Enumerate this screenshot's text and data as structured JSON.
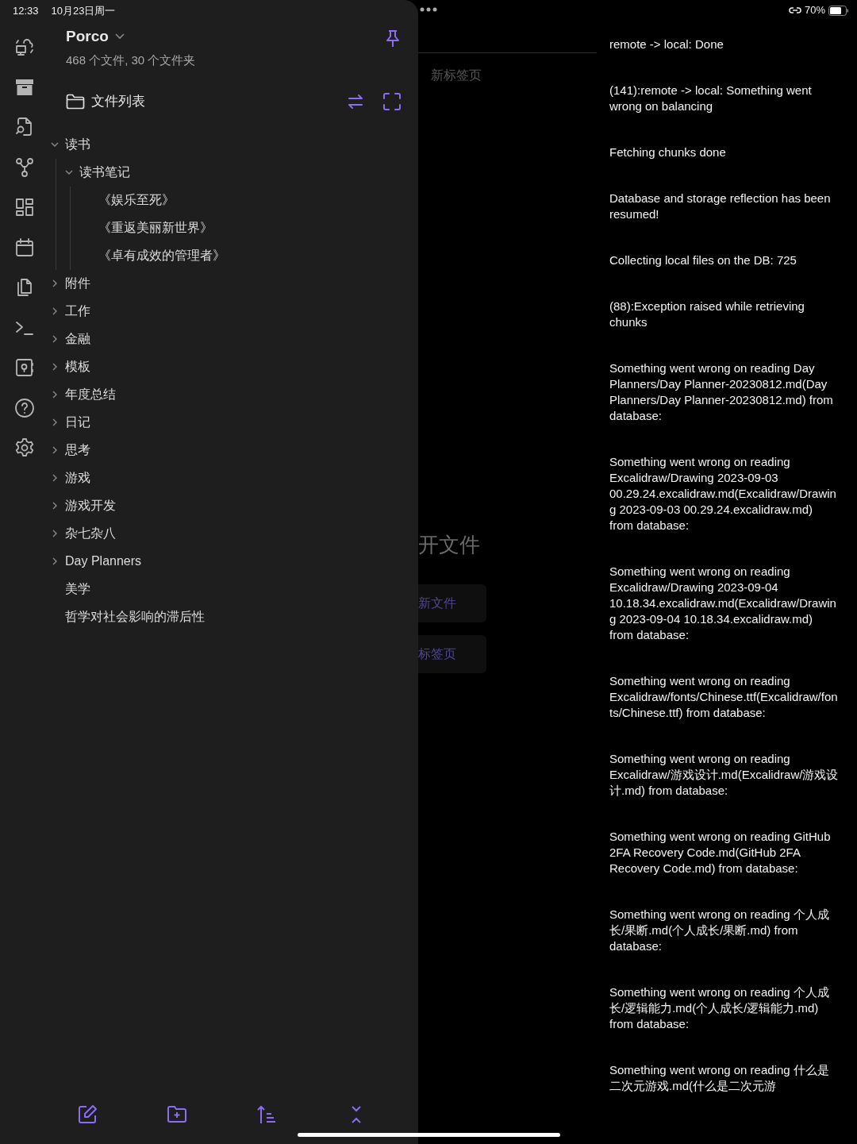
{
  "status_bar": {
    "time": "12:33",
    "date": "10月23日周一",
    "battery": "70%"
  },
  "vault": {
    "name": "Porco",
    "summary": "468 个文件, 30 个文件夹"
  },
  "file_pane": {
    "title": "文件列表"
  },
  "tree": [
    {
      "label": "读书",
      "kind": "folder",
      "expanded": true,
      "children": [
        {
          "label": "读书笔记",
          "kind": "folder",
          "expanded": true,
          "children": [
            {
              "label": "《娱乐至死》",
              "kind": "file"
            },
            {
              "label": "《重返美丽新世界》",
              "kind": "file"
            },
            {
              "label": "《卓有成效的管理者》",
              "kind": "file"
            }
          ]
        }
      ]
    },
    {
      "label": "附件",
      "kind": "folder",
      "expanded": false
    },
    {
      "label": "工作",
      "kind": "folder",
      "expanded": false
    },
    {
      "label": "金融",
      "kind": "folder",
      "expanded": false
    },
    {
      "label": "模板",
      "kind": "folder",
      "expanded": false
    },
    {
      "label": "年度总结",
      "kind": "folder",
      "expanded": false
    },
    {
      "label": "日记",
      "kind": "folder",
      "expanded": false
    },
    {
      "label": "思考",
      "kind": "folder",
      "expanded": false
    },
    {
      "label": "游戏",
      "kind": "folder",
      "expanded": false
    },
    {
      "label": "游戏开发",
      "kind": "folder",
      "expanded": false
    },
    {
      "label": "杂七杂八",
      "kind": "folder",
      "expanded": false
    },
    {
      "label": "Day Planners",
      "kind": "folder",
      "expanded": false
    },
    {
      "label": "美学",
      "kind": "file"
    },
    {
      "label": "哲学对社会影响的滞后性",
      "kind": "file"
    }
  ],
  "editor": {
    "tab_title": "新标签页",
    "heading": "开文件",
    "actions": [
      "新文件",
      "标签页"
    ]
  },
  "notices": [
    "remote -> local: Done",
    "(141):remote -> local: Something went wrong on balancing",
    "Fetching chunks done",
    "Database and storage reflection has been resumed!",
    "Collecting local files on the DB: 725",
    "(88):Exception raised while retrieving chunks",
    "Something went wrong on reading Day Planners/Day Planner-20230812.md(Day Planners/Day Planner-20230812.md) from database:",
    "Something went wrong on reading Excalidraw/Drawing 2023-09-03 00.29.24.excalidraw.md(Excalidraw/Drawing 2023-09-03 00.29.24.excalidraw.md) from database:",
    "Something went wrong on reading Excalidraw/Drawing 2023-09-04 10.18.34.excalidraw.md(Excalidraw/Drawing 2023-09-04 10.18.34.excalidraw.md) from database:",
    "Something went wrong on reading Excalidraw/fonts/Chinese.ttf(Excalidraw/fonts/Chinese.ttf) from database:",
    "Something went wrong on reading Excalidraw/游戏设计.md(Excalidraw/游戏设计.md) from database:",
    "Something went wrong on reading GitHub 2FA Recovery Code.md(GitHub 2FA Recovery Code.md) from database:",
    "Something went wrong on reading 个人成长/果断.md(个人成长/果断.md) from database:",
    "Something went wrong on reading 个人成长/逻辑能力.md(个人成长/逻辑能力.md) from database:",
    "Something went wrong on reading 什么是二次元游戏.md(什么是二次元游"
  ]
}
